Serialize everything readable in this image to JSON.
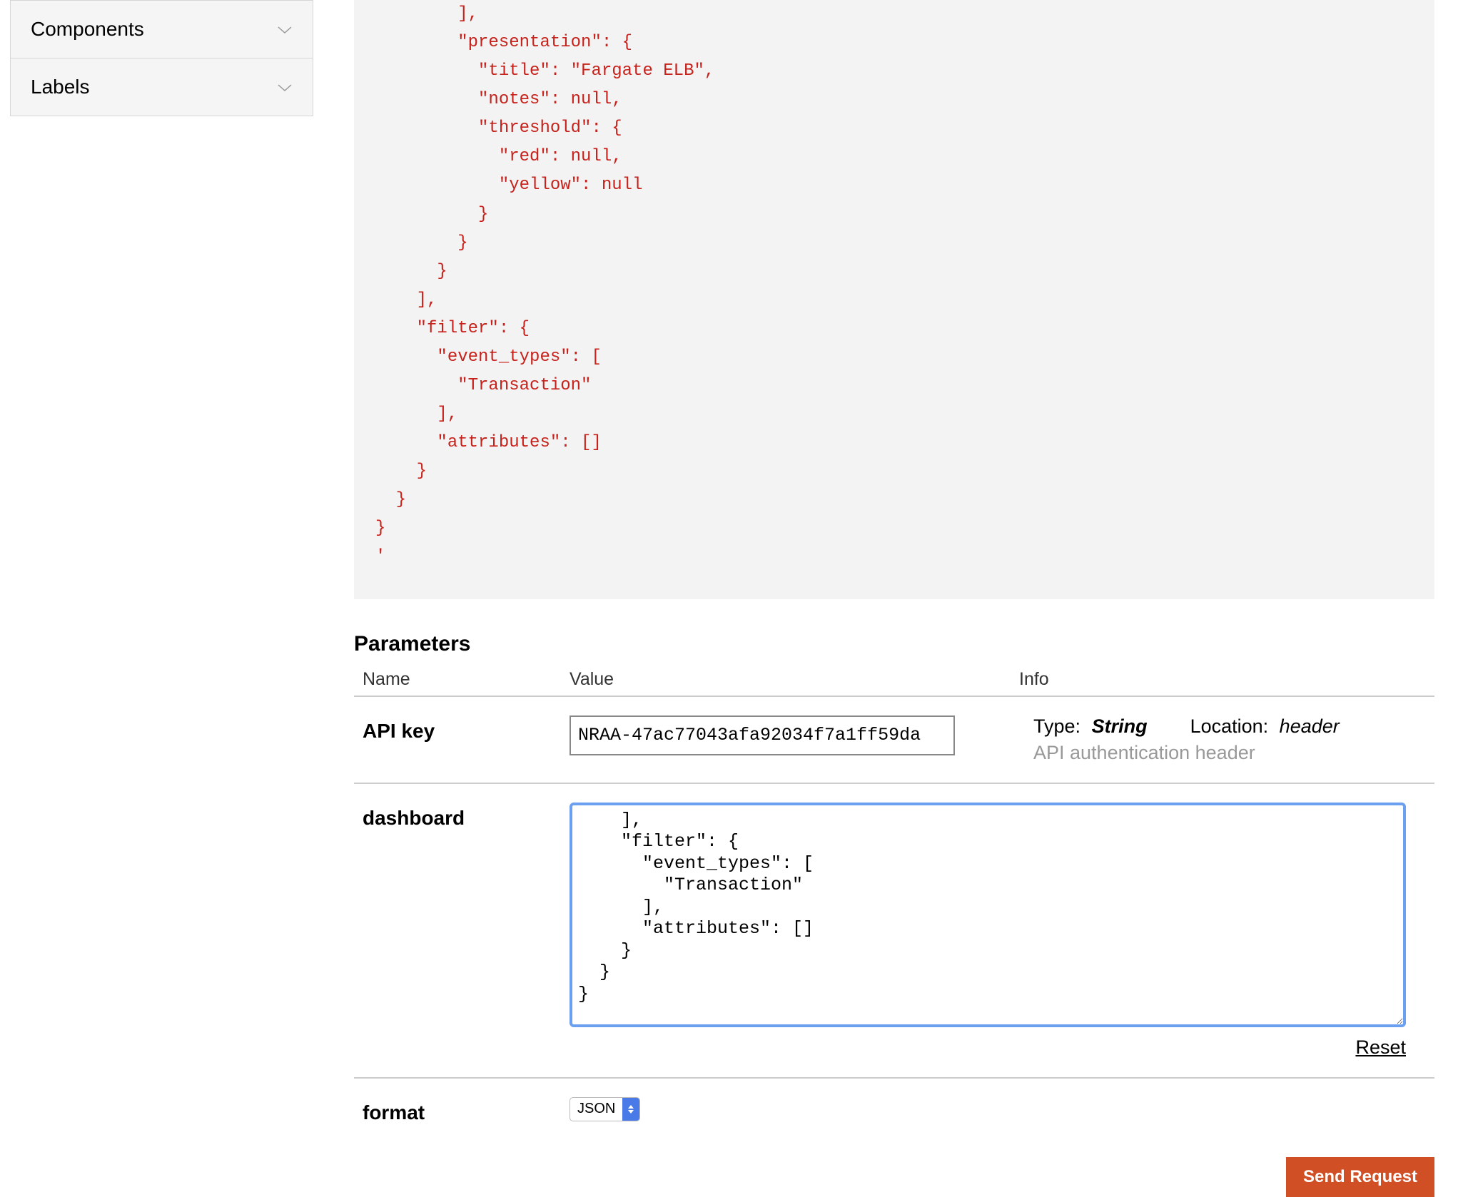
{
  "sidebar": {
    "items": [
      {
        "label": "Components"
      },
      {
        "label": "Labels"
      }
    ]
  },
  "code_block": "        ],\n        \"presentation\": {\n          \"title\": \"Fargate ELB\",\n          \"notes\": null,\n          \"threshold\": {\n            \"red\": null,\n            \"yellow\": null\n          }\n        }\n      }\n    ],\n    \"filter\": {\n      \"event_types\": [\n        \"Transaction\"\n      ],\n      \"attributes\": []\n    }\n  }\n}\n'",
  "parameters": {
    "title": "Parameters",
    "headers": {
      "name": "Name",
      "value": "Value",
      "info": "Info"
    },
    "rows": {
      "api_key": {
        "name": "API key",
        "value": "NRAA-47ac77043afa92034f7a1ff59da",
        "type_label": "Type:",
        "type_value": "String",
        "location_label": "Location:",
        "location_value": "header",
        "description": "API authentication header"
      },
      "dashboard": {
        "name": "dashboard",
        "value": "    ],\n    \"filter\": {\n      \"event_types\": [\n        \"Transaction\"\n      ],\n      \"attributes\": []\n    }\n  }\n}",
        "reset": "Reset"
      },
      "format": {
        "name": "format",
        "value": "JSON"
      }
    }
  },
  "buttons": {
    "send_request": "Send Request"
  }
}
